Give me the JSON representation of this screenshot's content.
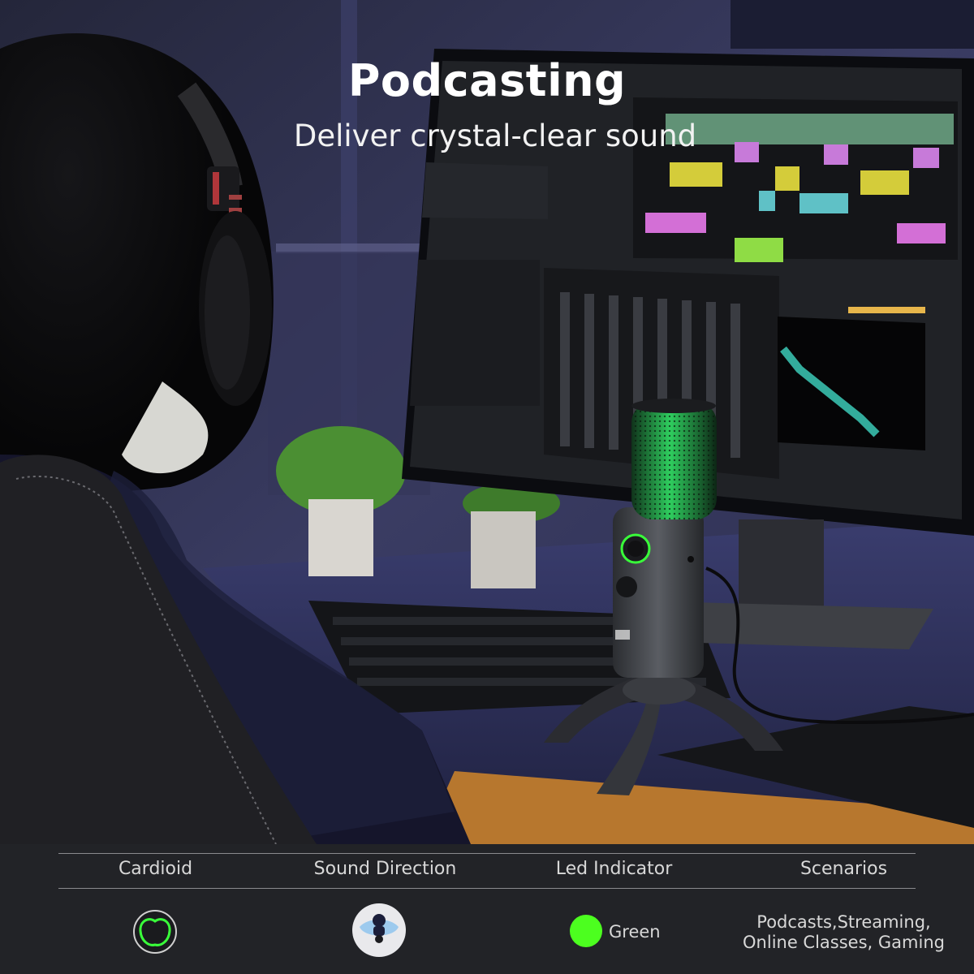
{
  "hero": {
    "title": "Podcasting",
    "subtitle": "Deliver crystal-clear sound"
  },
  "specs": {
    "headers": [
      "Cardioid",
      "Sound Direction",
      "Led Indicator",
      "Scenarios"
    ],
    "items": [
      {
        "icon": "cardioid-pattern-icon",
        "value": ""
      },
      {
        "icon": "sound-direction-icon",
        "value": ""
      },
      {
        "icon": "green-led-dot-icon",
        "value": "Green"
      },
      {
        "icon": "",
        "value_lines": [
          "Podcasts,Streaming,",
          "Online Classes, Gaming"
        ]
      }
    ]
  },
  "colors": {
    "accent_green": "#39ff3a",
    "led_dot": "#4cff1f",
    "panel_bg": "#222327",
    "rule": "#8a8a8e"
  }
}
